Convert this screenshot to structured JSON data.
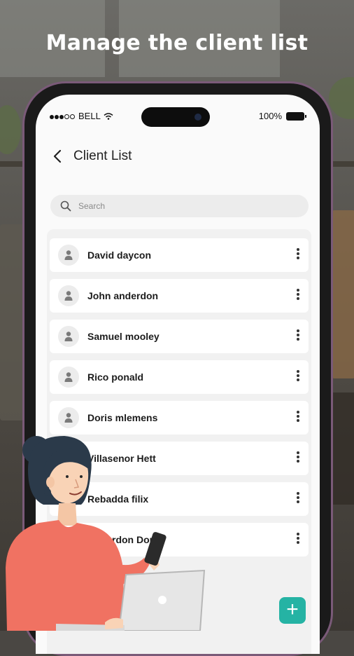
{
  "headline": "Manage the client list",
  "status": {
    "carrier": "BELL",
    "battery": "100%"
  },
  "header": {
    "title": "Client List"
  },
  "search": {
    "placeholder": "Search"
  },
  "clients": [
    {
      "name": "David daycon"
    },
    {
      "name": "John anderdon"
    },
    {
      "name": "Samuel mooley"
    },
    {
      "name": "Rico ponald"
    },
    {
      "name": "Doris mlemens"
    },
    {
      "name": "Villasenor Hett"
    },
    {
      "name": "Rebadda filix"
    },
    {
      "name": "Anderdon Doris"
    }
  ],
  "fab": {
    "label": "+"
  },
  "colors": {
    "accent": "#25b3a4",
    "phone_frame": "#7a5a78",
    "shirt": "#f07262"
  }
}
